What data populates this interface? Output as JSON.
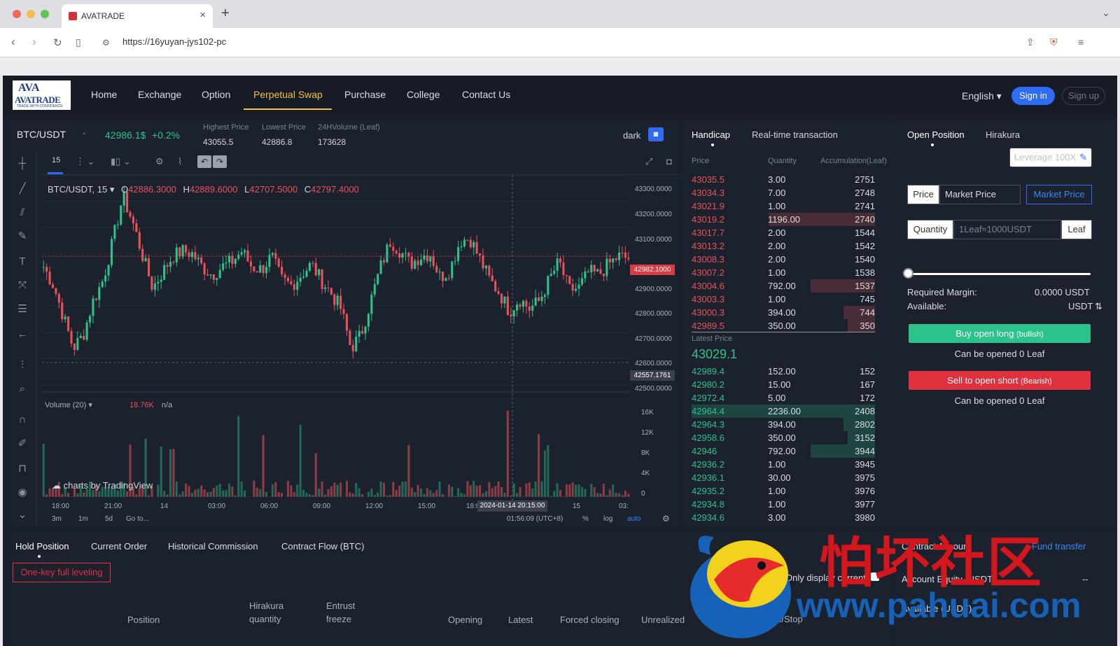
{
  "browser": {
    "tab_title": "AVATRADE",
    "url": "https://16yuyan-jys102-pc"
  },
  "header": {
    "logo_mark": "AVA",
    "logo_brand": "AVATRADE",
    "logo_tagline": "TRADE WITH CONFIDENCE",
    "menu": [
      "Home",
      "Exchange",
      "Option",
      "Perpetual Swap",
      "Purchase",
      "College",
      "Contact Us"
    ],
    "active_menu": "Perpetual Swap",
    "language": "English ▾",
    "sign_in": "Sign in",
    "sign_up": "Sign up"
  },
  "ticker": {
    "pair": "BTC/USDT",
    "last_price": "42986.1$",
    "change": "+0.2%",
    "high_label": "Highest Price",
    "high_value": "43055.5",
    "low_label": "Lowest Price",
    "low_value": "42886.8",
    "vol_label": "24HVolume  (Leaf)",
    "vol_value": "173628",
    "theme_label": "dark"
  },
  "chart": {
    "interval": "15",
    "legend_symbol": "BTC/USDT, 15 ▾",
    "ohlc": {
      "o": "42886.3000",
      "h": "42889.6000",
      "l": "42707.5000",
      "c": "42797.4000"
    },
    "volume_label": "Volume (20) ▾",
    "volume_value": "18.76K",
    "volume_na": "n/a",
    "watermark": "charts by TradingView",
    "y_ticks": [
      "43300.0000",
      "43200.0000",
      "43100.0000",
      "42900.0000",
      "42800.0000",
      "42700.0000",
      "42600.0000",
      "42500.0000"
    ],
    "current_price_tag": "42982.1000",
    "low_price_tag": "42557.1761",
    "vol_ticks": [
      "16K",
      "12K",
      "8K",
      "4K",
      "0"
    ],
    "x_ticks": [
      "18:00",
      "21:00",
      "14",
      "03:00",
      "06:00",
      "09:00",
      "12:00",
      "15:00",
      "18:0",
      "15",
      "03:"
    ],
    "crosshair_label": "2024-01-14 20:15:00",
    "ranges": [
      "3m",
      "1m",
      "5d",
      "Go to..."
    ],
    "clock": "01:56:09 (UTC+8)",
    "scale_options": [
      "%",
      "log",
      "auto"
    ]
  },
  "chart_data": {
    "type": "candlestick",
    "title": "BTC/USDT, 15",
    "ylim": [
      42500,
      43300
    ],
    "x": [
      "18:00",
      "21:00",
      "14",
      "03:00",
      "06:00",
      "09:00",
      "12:00",
      "15:00",
      "18:00",
      "15",
      "03:00"
    ],
    "close_path": [
      42950,
      42880,
      42760,
      42640,
      42690,
      42820,
      42900,
      43050,
      43220,
      43120,
      42990,
      42870,
      42930,
      42990,
      43010,
      43000,
      42950,
      42920,
      42950,
      42970,
      43010,
      42950,
      42940,
      42990,
      42900,
      42880,
      42920,
      42960,
      42900,
      42850,
      42790,
      42640,
      42690,
      42820,
      42950,
      43050,
      43010,
      42960,
      42990,
      43000,
      42910,
      42940,
      43050,
      43060,
      42980,
      42900,
      42850,
      42780,
      42830,
      42790,
      42820,
      42900,
      42970,
      42860,
      42870,
      42930,
      42920,
      42960,
      42990,
      42982
    ],
    "volume_ylim": [
      0,
      18760
    ]
  },
  "orderbook": {
    "tab_active": "Handicap",
    "tab_other": "Real-time transaction",
    "headers": {
      "price": "Price",
      "qty": "Quantity",
      "acc": "Accumulation(Leaf)"
    },
    "asks": [
      {
        "price": "43035.5",
        "qty": "3.00",
        "acc": "2751",
        "depth": 0.0
      },
      {
        "price": "43034.3",
        "qty": "7.00",
        "acc": "2748",
        "depth": 0.0
      },
      {
        "price": "43021.9",
        "qty": "1.00",
        "acc": "2741",
        "depth": 0.0
      },
      {
        "price": "43019.2",
        "qty": "1196.00",
        "acc": "2740",
        "depth": 0.58
      },
      {
        "price": "43017.7",
        "qty": "2.00",
        "acc": "1544",
        "depth": 0.0
      },
      {
        "price": "43013.2",
        "qty": "2.00",
        "acc": "1542",
        "depth": 0.0
      },
      {
        "price": "43008.3",
        "qty": "2.00",
        "acc": "1540",
        "depth": 0.0
      },
      {
        "price": "43007.2",
        "qty": "1.00",
        "acc": "1538",
        "depth": 0.0
      },
      {
        "price": "43004.6",
        "qty": "792.00",
        "acc": "1537",
        "depth": 0.35
      },
      {
        "price": "43003.3",
        "qty": "1.00",
        "acc": "745",
        "depth": 0.0
      },
      {
        "price": "43000.3",
        "qty": "394.00",
        "acc": "744",
        "depth": 0.17
      },
      {
        "price": "42989.5",
        "qty": "350.00",
        "acc": "350",
        "depth": 0.15
      }
    ],
    "latest_label": "Latest Price",
    "latest_price": "43029.1",
    "bids": [
      {
        "price": "42989.4",
        "qty": "152.00",
        "acc": "152",
        "depth": 0.0
      },
      {
        "price": "42980.2",
        "qty": "15.00",
        "acc": "167",
        "depth": 0.0
      },
      {
        "price": "42972.4",
        "qty": "5.00",
        "acc": "172",
        "depth": 0.0
      },
      {
        "price": "42964.4",
        "qty": "2236.00",
        "acc": "2408",
        "depth": 1.0
      },
      {
        "price": "42964.3",
        "qty": "394.00",
        "acc": "2802",
        "depth": 0.17
      },
      {
        "price": "42958.6",
        "qty": "350.00",
        "acc": "3152",
        "depth": 0.15
      },
      {
        "price": "42946",
        "qty": "792.00",
        "acc": "3944",
        "depth": 0.35
      },
      {
        "price": "42936.2",
        "qty": "1.00",
        "acc": "3945",
        "depth": 0.0
      },
      {
        "price": "42936.1",
        "qty": "30.00",
        "acc": "3975",
        "depth": 0.0
      },
      {
        "price": "42935.2",
        "qty": "1.00",
        "acc": "3976",
        "depth": 0.0
      },
      {
        "price": "42934.8",
        "qty": "1.00",
        "acc": "3977",
        "depth": 0.0
      },
      {
        "price": "42934.6",
        "qty": "3.00",
        "acc": "3980",
        "depth": 0.0
      }
    ]
  },
  "order_form": {
    "tab_active": "Open Position",
    "tab_other": "Hirakura",
    "leverage_placeholder": "Leverage 100X",
    "price_label": "Price",
    "price_value": "Market Price",
    "market_button": "Market Price",
    "qty_label": "Quantity",
    "qty_placeholder": "1Leaf≈1000USDT",
    "qty_unit": "Leaf",
    "slider_percent": 0,
    "margin_label": "Required Margin:",
    "margin_value": "0.0000 USDT",
    "available_label": "Available:",
    "available_value": "USDT",
    "buy_label": "Buy open long",
    "buy_sub": "(bullish)",
    "buy_can_open": "Can be opened 0 Leaf",
    "sell_label": "Sell to open short",
    "sell_sub": "(Bearish)",
    "sell_can_open": "Can be opened 0 Leaf"
  },
  "bottom": {
    "tabs": [
      "Hold Position",
      "Current Order",
      "Historical Commission",
      "Contract Flow  (BTC)"
    ],
    "one_key": "One-key full leveling",
    "only_display": "Only display current",
    "columns": [
      "Position",
      "Hirakura quantity",
      "Entrust freeze",
      "Opening",
      "Latest",
      "Forced closing",
      "Unrealized",
      "Stop Profit/Stop"
    ]
  },
  "account": {
    "title": "Contract Account",
    "transfer": "Fund transfer",
    "equity_label": "Account Equity (USDT)",
    "equity_value": "--",
    "available_label": "Available (USDT)"
  },
  "watermark": {
    "cn_text": "怕坏社区",
    "url_text": "www.pahuai.com"
  },
  "colors": {
    "up": "#2cc38a",
    "down": "#e8525a",
    "accent": "#f1c24a",
    "primary": "#2f6cf6"
  }
}
